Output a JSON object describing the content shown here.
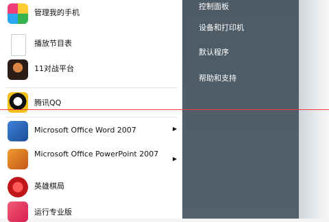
{
  "left": {
    "apps": [
      {
        "label": "管理我的手机",
        "icon": "phone-manager-icon"
      },
      {
        "label": "播放节目表",
        "icon": "document-icon"
      },
      {
        "label": "11对战平台",
        "icon": "game-platform-icon"
      },
      {
        "label": "腾讯QQ",
        "icon": "qq-icon"
      },
      {
        "label": "Microsoft Office Word 2007",
        "icon": "word-icon"
      },
      {
        "label": "Microsoft Office PowerPoint 2007",
        "icon": "powerpoint-icon"
      },
      {
        "label": "英雄棋局",
        "icon": "hero-game-icon"
      },
      {
        "label": "运行专业版",
        "icon": "pro-app-icon"
      }
    ]
  },
  "right": {
    "items": [
      "控制面板",
      "设备和打印机",
      "默认程序",
      "帮助和支持"
    ]
  },
  "colors": {
    "panel_dark": "#4d5b67",
    "guide_line": "#f13a3a"
  }
}
